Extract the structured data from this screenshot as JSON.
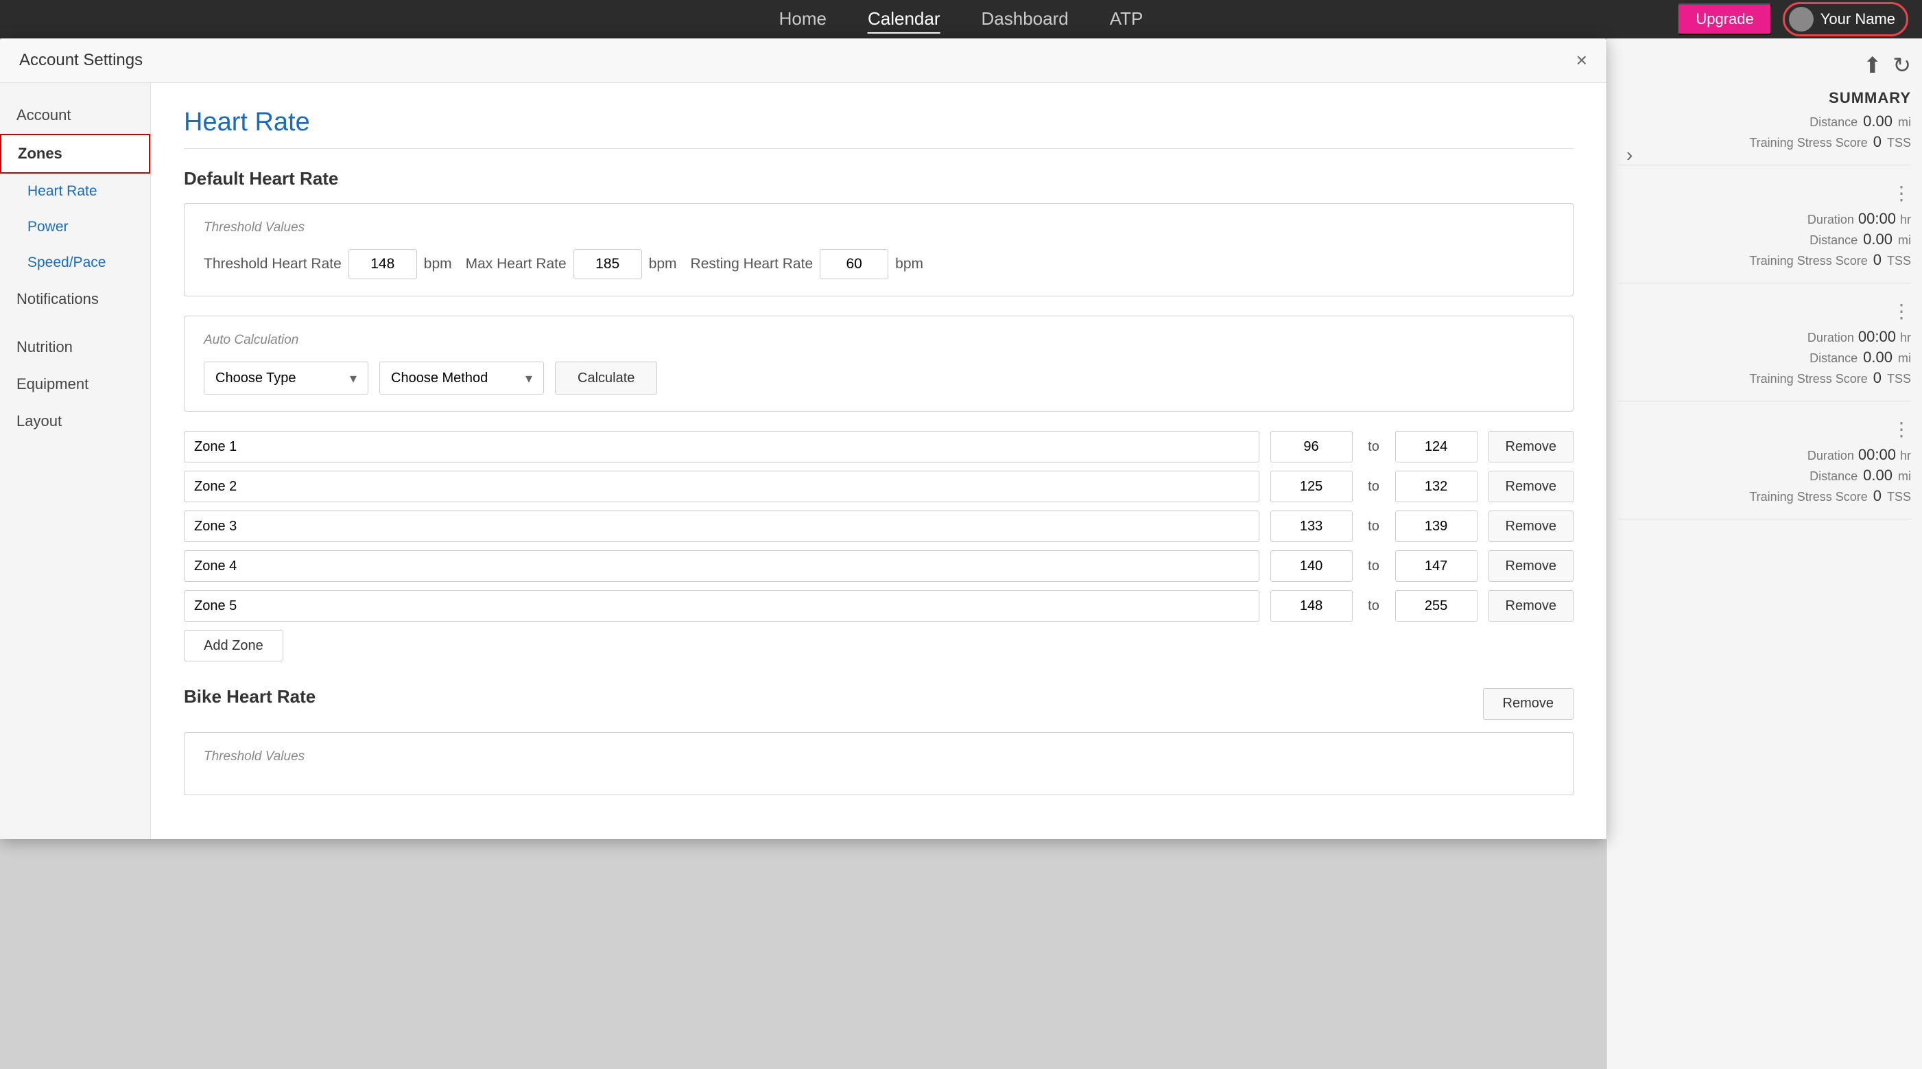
{
  "topnav": {
    "links": [
      {
        "label": "Home",
        "active": false
      },
      {
        "label": "Calendar",
        "active": true
      },
      {
        "label": "Dashboard",
        "active": false
      },
      {
        "label": "ATP",
        "active": false
      }
    ],
    "upgrade_label": "Upgrade",
    "user_name": "Your Name"
  },
  "modal": {
    "title": "Account Settings",
    "close_label": "×",
    "sidebar": {
      "items": [
        {
          "label": "Account",
          "level": "top",
          "active": false
        },
        {
          "label": "Zones",
          "level": "top",
          "active": true
        },
        {
          "label": "Heart Rate",
          "level": "sub",
          "active": true
        },
        {
          "label": "Power",
          "level": "sub",
          "active": false
        },
        {
          "label": "Speed/Pace",
          "level": "sub",
          "active": false
        },
        {
          "label": "Notifications",
          "level": "top",
          "active": false
        },
        {
          "label": "Nutrition",
          "level": "top",
          "active": false
        },
        {
          "label": "Equipment",
          "level": "top",
          "active": false
        },
        {
          "label": "Layout",
          "level": "top",
          "active": false
        }
      ]
    },
    "content": {
      "section_title": "Heart Rate",
      "default_hr_title": "Default Heart Rate",
      "threshold_card_label": "Threshold Values",
      "threshold_hr_label": "Threshold Heart Rate",
      "threshold_hr_value": "148",
      "threshold_hr_unit": "bpm",
      "max_hr_label": "Max Heart Rate",
      "max_hr_value": "185",
      "max_hr_unit": "bpm",
      "resting_hr_label": "Resting Heart Rate",
      "resting_hr_value": "60",
      "resting_hr_unit": "bpm",
      "auto_calc_label": "Auto Calculation",
      "choose_type_placeholder": "Choose Type",
      "choose_method_placeholder": "Choose Method",
      "calculate_btn": "Calculate",
      "zones": [
        {
          "name": "Zone 1",
          "from": "96",
          "to": "124"
        },
        {
          "name": "Zone 2",
          "from": "125",
          "to": "132"
        },
        {
          "name": "Zone 3",
          "from": "133",
          "to": "139"
        },
        {
          "name": "Zone 4",
          "from": "140",
          "to": "147"
        },
        {
          "name": "Zone 5",
          "from": "148",
          "to": "255"
        }
      ],
      "remove_label": "Remove",
      "add_zone_label": "Add Zone",
      "bike_hr_title": "Bike Heart Rate",
      "bike_remove_label": "Remove",
      "threshold_values_label": "Threshold Values",
      "to_label": "to"
    }
  },
  "right_panel": {
    "summary_title": "SUMMARY",
    "distance_label": "Distance",
    "distance_value": "0.00",
    "distance_unit": "mi",
    "tss_label": "Training Stress Score",
    "tss_value": "0",
    "tss_unit": "TSS",
    "sections": [
      {
        "duration_label": "Duration",
        "duration_value": "00:00",
        "duration_unit": "hr",
        "distance_label": "Distance",
        "distance_value": "0.00",
        "distance_unit": "mi",
        "tss_label": "Training Stress Score",
        "tss_value": "0",
        "tss_unit": "TSS"
      },
      {
        "duration_label": "Duration",
        "duration_value": "00:00",
        "duration_unit": "hr",
        "distance_label": "Distance",
        "distance_value": "0.00",
        "distance_unit": "mi",
        "tss_label": "Training Stress Score",
        "tss_value": "0",
        "tss_unit": "TSS"
      },
      {
        "duration_label": "Duration",
        "duration_value": "00:00",
        "duration_unit": "hr",
        "distance_label": "Distance",
        "distance_value": "0.00",
        "distance_unit": "mi",
        "tss_label": "Training Stress Score",
        "tss_value": "0",
        "tss_unit": "TSS"
      }
    ]
  }
}
